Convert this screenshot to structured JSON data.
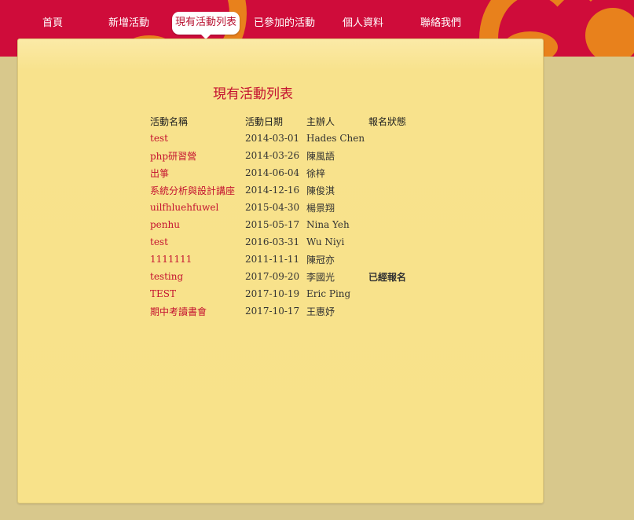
{
  "nav": {
    "items": [
      {
        "label": "首頁",
        "active": false
      },
      {
        "label": "新增活動",
        "active": false
      },
      {
        "label": "現有活動列表",
        "active": true
      },
      {
        "label": "已參加的活動",
        "active": false
      },
      {
        "label": "個人資料",
        "active": false
      },
      {
        "label": "聯絡我們",
        "active": false
      }
    ]
  },
  "page": {
    "title": "現有活動列表"
  },
  "table": {
    "headers": [
      "活動名稱",
      "活動日期",
      "主辦人",
      "報名狀態"
    ],
    "rows": [
      {
        "name": "test",
        "date": "2014-03-01",
        "host": "Hades Chen",
        "status": ""
      },
      {
        "name": "php研習營",
        "date": "2014-03-26",
        "host": "陳風語",
        "status": ""
      },
      {
        "name": "出箏",
        "date": "2014-06-04",
        "host": "徐梓",
        "status": ""
      },
      {
        "name": "系統分析與設計講座",
        "date": "2014-12-16",
        "host": "陳俊淇",
        "status": ""
      },
      {
        "name": "uilfhluehfuwel",
        "date": "2015-04-30",
        "host": "楊景翔",
        "status": ""
      },
      {
        "name": "penhu",
        "date": "2015-05-17",
        "host": "Nina Yeh",
        "status": ""
      },
      {
        "name": "test",
        "date": "2016-03-31",
        "host": "Wu Niyi",
        "status": ""
      },
      {
        "name": "1111111",
        "date": "2011-11-11",
        "host": "陳冠亦",
        "status": ""
      },
      {
        "name": "testing",
        "date": "2017-09-20",
        "host": "李國光",
        "status": "已經報名"
      },
      {
        "name": "TEST",
        "date": "2017-10-19",
        "host": "Eric Ping",
        "status": ""
      },
      {
        "name": "期中考讀書會",
        "date": "2017-10-17",
        "host": "王惠妤",
        "status": ""
      }
    ]
  },
  "colors": {
    "header_red": "#cf0c3a",
    "swirl_orange": "#e8811c",
    "panel_yellow": "#f8e28a",
    "page_background": "#d8c88c",
    "link_red": "#c41230",
    "status_red": "#cc0a1a"
  }
}
